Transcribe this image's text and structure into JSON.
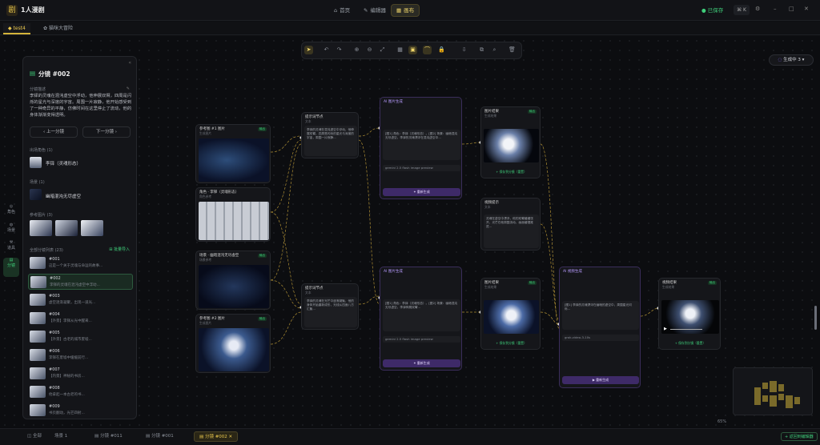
{
  "app": {
    "logo": "剧",
    "name": "1人漫剧"
  },
  "nav": {
    "home": "首页",
    "editor": "编辑器",
    "canvas": "画布"
  },
  "status": {
    "saved": "● 已保存",
    "shortcut": "⌘ K"
  },
  "tabs": [
    {
      "label": "test4"
    },
    {
      "label": "猫咪大冒险"
    }
  ],
  "status_pill": "生成中 3",
  "panel": {
    "title": "分镜 #002",
    "desc_label": "分镜描述",
    "desc": "李铎的灵魂在混沌虚空中浮动，他伸展双臂，四周是闪烁的星光与深邃的宇宙。周围一片寂静，他开始感受到了一种奇异的平静，仿佛时间在这里停止了流动，他的身体渐渐变得透明。",
    "prev": "‹ 上一分镜",
    "next": "下一分镜 ›",
    "char_label": "出场角色 (1)",
    "char_name": "李铎（灵魂形态）",
    "scene_label": "场景 (1)",
    "scene_name": "幽暗混沌无尽虚空",
    "ref_label": "参考图片 (3)",
    "list_label": "全部分镜列表 (23)",
    "batch": "批量导入",
    "list": [
      {
        "id": "#001",
        "text": "这是一个关于灵魂与命运的故事..."
      },
      {
        "id": "#002",
        "text": "李铎的灵魂在混沌虚空中浮动..."
      },
      {
        "id": "#003",
        "text": "虚空逐渐凝聚，出现一道光..."
      },
      {
        "id": "#004",
        "text": "【外景】李铎从光中醒来..."
      },
      {
        "id": "#005",
        "text": "【外景】古老的城市废墟..."
      },
      {
        "id": "#006",
        "text": "李铎在废墟中缓缓前行..."
      },
      {
        "id": "#007",
        "text": "【内景】神秘的书房..."
      },
      {
        "id": "#008",
        "text": "他拿起一本古老的书..."
      },
      {
        "id": "#009",
        "text": "书页翻动，光芒四射..."
      }
    ]
  },
  "rail": [
    {
      "icon": "◎",
      "label": "角色"
    },
    {
      "icon": "◍",
      "label": "场景"
    },
    {
      "icon": "⚒",
      "label": "道具"
    },
    {
      "icon": "▤",
      "label": "分镜"
    }
  ],
  "nodes": {
    "img1": {
      "title": "参考图 #1 图片",
      "sub": "生成图片",
      "badge": "输出"
    },
    "img2": {
      "title": "角色 · 李铎（灵魂形态）",
      "sub": "角色参考",
      "badge": "输出"
    },
    "img3": {
      "title": "场景 · 幽暗混沌无尽虚空",
      "sub": "场景参考",
      "badge": "输出"
    },
    "img4": {
      "title": "参考图 #2 图片",
      "sub": "生成图片",
      "badge": "输出"
    },
    "text1": {
      "title": "提示词节点",
      "sub": "文本",
      "body": "李铎的灵魂在混沌虚空中浮动，他伸展双臂，四周是闪烁的星光与深邃的宇宙，周围一片寂静..."
    },
    "text2": {
      "title": "提示词节点",
      "sub": "文本",
      "body": "李铎的灵魂在光芒中逐渐凝聚，他的身体开始重新成形，光线从四面八方汇聚..."
    },
    "gen1": {
      "title": "AI 图片生成",
      "model": "gemini 2.5 flash image preview",
      "button": "✦ 重新生成",
      "body": "[图1] 角色：李铎（灵魂形态）。[图2] 场景：幽暗混沌无尽虚空。李铎的灵魂漂浮在混沌虚空中..."
    },
    "gen2": {
      "title": "AI 图片生成",
      "model": "gemini 2.5 flash image preview",
      "button": "✦ 重新生成",
      "body": "[图1] 角色：李铎（灵魂形态）。[图2] 场景：幽暗混沌无尽虚空。李铎伸展双臂..."
    },
    "out1": {
      "title": "图片结果",
      "sub": "生成结果",
      "badge": "输出",
      "save": "+ 保存到分镜（重置）"
    },
    "out2": {
      "title": "图片结果",
      "sub": "生成结果",
      "badge": "输出",
      "save": "+ 保存到分镜（重置）"
    },
    "txtout": {
      "title": "视频提示",
      "sub": "文本",
      "body": "灵魂在虚空中漂浮，他的双臂缓缓张开，光芒在他周围流动，画面缓慢推进..."
    },
    "vgen": {
      "title": "AI 视频生成",
      "model": "grok-video-3-10s",
      "button": "▶ 重新生成",
      "body": "[图1] 李铎的灵魂漂浮在幽暗的虚空中，周围星光闪烁..."
    },
    "vout": {
      "title": "视频结果",
      "sub": "生成结果",
      "badge": "输出",
      "save": "+ 保存到分镜（重置）"
    }
  },
  "zoom": "65%",
  "bottom": {
    "all": "全部",
    "items": [
      "场景 1",
      "分镜 #011",
      "分镜 #001",
      "分镜 #002"
    ],
    "back": "+ 返回到编辑器"
  },
  "colors": {
    "accent": "#e9c74d",
    "success": "#3fce7a",
    "purple": "#3e2a68"
  }
}
